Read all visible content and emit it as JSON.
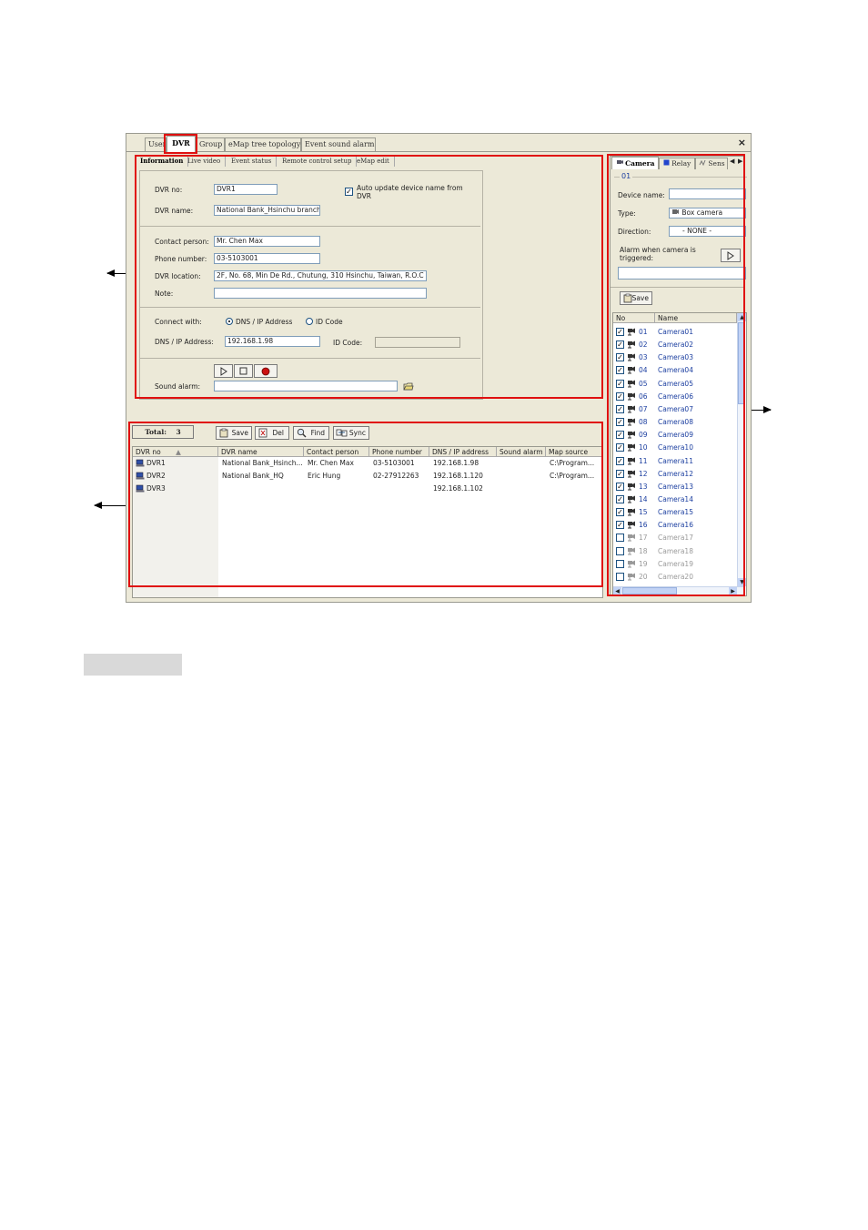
{
  "tabs": [
    "User",
    "DVR",
    "Group",
    "eMap tree topology",
    "Event sound alarm"
  ],
  "close_label": "×",
  "subtabs": [
    "Information",
    "Live video",
    "Event status",
    "Remote control setup",
    "eMap edit"
  ],
  "info": {
    "dvr_no_label": "DVR no:",
    "dvr_no": "DVR1",
    "auto_update_label": "Auto update device name from DVR",
    "dvr_name_label": "DVR name:",
    "dvr_name": "National Bank_Hsinchu branch",
    "contact_label": "Contact person:",
    "contact": "Mr. Chen Max",
    "phone_label": "Phone number:",
    "phone": "03-5103001",
    "location_label": "DVR location:",
    "location": "2F, No. 68, Min De Rd., Chutung, 310 Hsinchu, Taiwan, R.O.C",
    "note_label": "Note:",
    "note": "",
    "connect_label": "Connect with:",
    "opt_dns": "DNS / IP Address",
    "opt_id": "ID Code",
    "dns_label": "DNS / IP Address:",
    "dns": "192.168.1.98",
    "idcode_label": "ID Code:",
    "idcode": "",
    "sound_label": "Sound alarm:",
    "sound": ""
  },
  "list": {
    "total_label": "Total:",
    "total": "3",
    "buttons": [
      "Save",
      "Del",
      "Find",
      "Sync"
    ],
    "headers": [
      "DVR no",
      "DVR name",
      "Contact person",
      "Phone number",
      "DNS / IP address",
      "Sound alarm",
      "Map source"
    ],
    "rows": [
      [
        "DVR1",
        "National Bank_Hsinch...",
        "Mr. Chen Max",
        "03-5103001",
        "192.168.1.98",
        "",
        "C:\\Program..."
      ],
      [
        "DVR2",
        "National Bank_HQ",
        "Eric Hung",
        "02-27912263",
        "192.168.1.120",
        "",
        "C:\\Program..."
      ],
      [
        "DVR3",
        "",
        "",
        "",
        "192.168.1.102",
        "",
        ""
      ]
    ]
  },
  "right": {
    "tabs": [
      "Camera",
      "Relay",
      "Sens"
    ],
    "group_title": "01",
    "device_name_label": "Device name:",
    "device_name": "",
    "type_label": "Type:",
    "type": "Box camera",
    "direction_label": "Direction:",
    "direction": "- NONE -",
    "alarm_label": "Alarm when camera is triggered:",
    "save_label": "Save",
    "col_no": "No",
    "col_name": "Name",
    "cameras": [
      {
        "no": "01",
        "name": "Camera01",
        "on": true
      },
      {
        "no": "02",
        "name": "Camera02",
        "on": true
      },
      {
        "no": "03",
        "name": "Camera03",
        "on": true
      },
      {
        "no": "04",
        "name": "Camera04",
        "on": true
      },
      {
        "no": "05",
        "name": "Camera05",
        "on": true
      },
      {
        "no": "06",
        "name": "Camera06",
        "on": true
      },
      {
        "no": "07",
        "name": "Camera07",
        "on": true
      },
      {
        "no": "08",
        "name": "Camera08",
        "on": true
      },
      {
        "no": "09",
        "name": "Camera09",
        "on": true
      },
      {
        "no": "10",
        "name": "Camera10",
        "on": true
      },
      {
        "no": "11",
        "name": "Camera11",
        "on": true
      },
      {
        "no": "12",
        "name": "Camera12",
        "on": true
      },
      {
        "no": "13",
        "name": "Camera13",
        "on": true
      },
      {
        "no": "14",
        "name": "Camera14",
        "on": true
      },
      {
        "no": "15",
        "name": "Camera15",
        "on": true
      },
      {
        "no": "16",
        "name": "Camera16",
        "on": true
      },
      {
        "no": "17",
        "name": "Camera17",
        "on": false
      },
      {
        "no": "18",
        "name": "Camera18",
        "on": false
      },
      {
        "no": "19",
        "name": "Camera19",
        "on": false
      },
      {
        "no": "20",
        "name": "Camera20",
        "on": false
      }
    ]
  },
  "colors": {
    "highlight": "#e01010",
    "selected_blue": "#316ac5",
    "disabled_text": "#9a9a9a"
  }
}
